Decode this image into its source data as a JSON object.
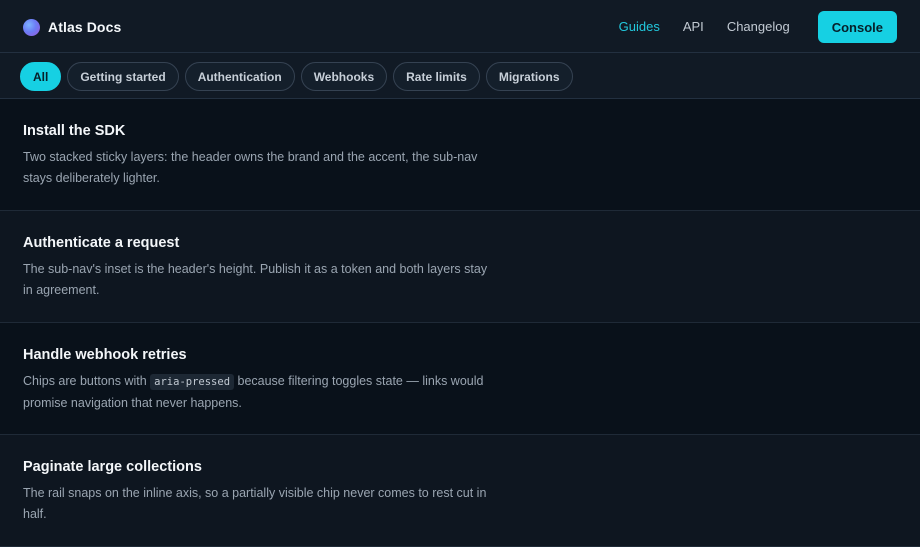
{
  "header": {
    "brand": "Atlas Docs",
    "nav": [
      {
        "label": "Guides",
        "active": true
      },
      {
        "label": "API"
      },
      {
        "label": "Changelog"
      }
    ],
    "console_label": "Console",
    "accent_color": "#16d0e3"
  },
  "subnav": {
    "chips": [
      {
        "label": "All",
        "pressed": true
      },
      {
        "label": "Getting started"
      },
      {
        "label": "Authentication"
      },
      {
        "label": "Webhooks"
      },
      {
        "label": "Rate limits"
      },
      {
        "label": "Migrations"
      }
    ]
  },
  "cards": [
    {
      "title": "Install the SDK",
      "body": "Two stacked sticky layers: the header owns the brand and the accent, the sub-nav stays deliberately lighter."
    },
    {
      "title": "Authenticate a request",
      "body": "The sub-nav's inset is the header's height. Publish it as a token and both layers stay in agreement."
    },
    {
      "title": "Handle webhook retries",
      "body_before": "Chips are buttons with ",
      "body_code": "aria-pressed",
      "body_after": " because filtering toggles state — links would promise navigation that never happens."
    },
    {
      "title": "Paginate large collections",
      "body": "The rail snaps on the inline axis, so a partially visible chip never comes to rest cut in half."
    }
  ]
}
